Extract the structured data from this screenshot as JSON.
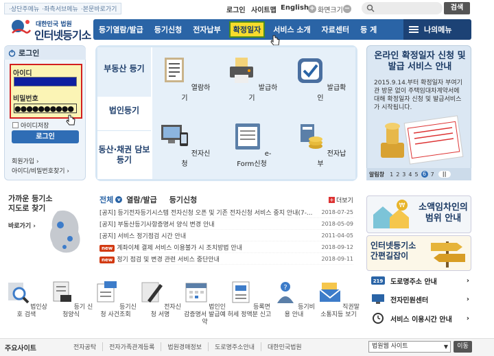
{
  "topbar": {
    "skip_links": [
      "상단주메뉴",
      "좌측서브메뉴",
      "본문바로가기"
    ],
    "login": "로그인",
    "sitemap": "사이트맵",
    "english": "English",
    "zoom_label": "화면크기",
    "search_button": "검색"
  },
  "logo": {
    "sub": "대한민국 법원",
    "name": "인터넷등기소"
  },
  "gnb": {
    "items": [
      "등기열람/발급",
      "등기신청",
      "전자납부",
      "확정일자",
      "서비스 소개",
      "자료센터",
      "등 게"
    ],
    "highlighted": "확정일자",
    "my_menu": "나의메뉴"
  },
  "login": {
    "title": "로그인",
    "id_label": "아이디",
    "pw_label": "비밀번호",
    "pw_masked": "●●●●●●●●●●",
    "save_id": "아이디저장",
    "button": "로그인",
    "join": "회원가입",
    "find": "아이디/비밀번호찾기"
  },
  "panel": {
    "tabs": [
      "부동산 등기",
      "법인등기",
      "동산·채권 담보 등기"
    ],
    "services": [
      "열람하기",
      "발급하기",
      "발급확인",
      "전자신청",
      "e-Form신청",
      "전자납부"
    ]
  },
  "banner": {
    "title": "온라인 확정일자 신청 및 발급 서비스 안내",
    "desc": "2015.9.14.부터 확정일자 부여기관 방문 없이 주택임대차계약서에 대해 확정일자 신청 및 발급서비스가 시작됩니다.",
    "control_label": "알림창",
    "pages": [
      "1",
      "2",
      "3",
      "4",
      "5",
      "6",
      "7"
    ],
    "active_page": "6"
  },
  "near": {
    "title": "가까운 등기소 지도로 찾기",
    "button": "바로가기"
  },
  "notices": {
    "tabs": [
      "전체",
      "열람/발급",
      "등기신청"
    ],
    "more": "더보기",
    "rows": [
      {
        "badge": "",
        "title": "[공지] 등기전자등기시스템 전자신청 오픈 및 기존 전자신청 서비스 중지 안내(7-...",
        "date": "2018-07-25"
      },
      {
        "badge": "",
        "title": "[공지] 부동산등기사항증명서 양식 변경 안내",
        "date": "2018-05-09"
      },
      {
        "badge": "",
        "title": "[공지] 서비스 정기점검 시간 안내",
        "date": "2011-04-05"
      },
      {
        "badge": "new",
        "title": "계좌이체 결제 서비스 이용불가 시 조치방법 안내",
        "date": "2018-09-12"
      },
      {
        "badge": "new",
        "title": "정기 점검 및 변경 관련 서비스 중단안내",
        "date": "2018-09-11"
      }
    ]
  },
  "side": {
    "promo1": "소액임차인의 범위 안내",
    "promo2": "인터넷등기소 간편길잡이",
    "links": [
      "도로명주소 안내",
      "전자민원센터",
      "서비스 이용시간 안내"
    ]
  },
  "quick": [
    "법인상호 검색",
    "등기 신청양식",
    "등기신청 사건조회",
    "전자신청 서명",
    "법인인감증명서 발급예약",
    "등록면허세 정액분 신고",
    "등기비용 안내",
    "직권말소통지등 보기"
  ],
  "footer": {
    "title": "주요사이트",
    "links": [
      "전자공탁",
      "전자가족관계등록",
      "법원경매정보",
      "도로명주소안내",
      "대한민국법원"
    ],
    "select": "법원웹 사이트",
    "go": "이동"
  },
  "colors": {
    "primary": "#2a64a6",
    "navy": "#1c4275",
    "highlight": "#f7dc2c",
    "alert": "#d31e1e"
  }
}
